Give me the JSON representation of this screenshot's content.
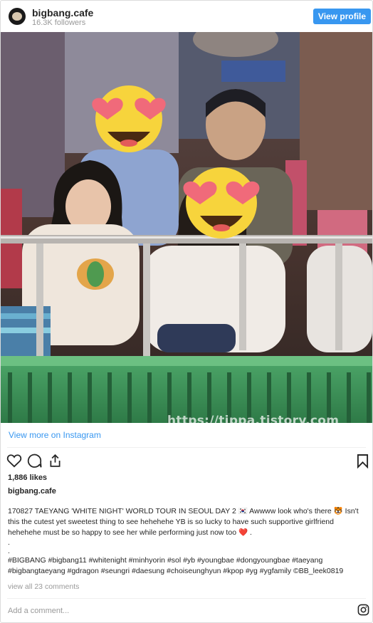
{
  "header": {
    "username": "bigbang.cafe",
    "followers": "16.3K followers",
    "view_profile_label": "View profile",
    "avatar_icon": "profile-avatar"
  },
  "photo": {
    "watermark": "https://tippa.tistory.com",
    "face_cover_icon": "heart-eyes-emoji"
  },
  "post": {
    "view_more_label": "View more on Instagram",
    "likes": "1,886 likes",
    "owner": "bigbang.cafe",
    "caption_text": "170827 TAEYANG 'WHITE NIGHT' WORLD TOUR IN SEOUL DAY 2 🇰🇷 Awwww look who's there 🐯 Isn't this the cutest yet sweetest thing to see hehehehe YB is so lucky to have such supportive girlfriend hehehehe must be so happy to see her while performing just now too ❤️ .",
    "dot1": ".",
    "dot2": ".",
    "hashtags": "#BIGBANG #bigbang11 #whitenight #minhyorin #sol #yb #youngbae #dongyoungbae #taeyang #bigbangtaeyang #gdragon #seungri #daesung #choiseunghyun #kpop #yg #ygfamily ©BB_leek0819",
    "view_comments": "view all 23 comments",
    "add_comment_placeholder": "Add a comment..."
  },
  "icons": {
    "like": "heart-outline-icon",
    "comment": "comment-bubble-icon",
    "share": "share-icon",
    "save": "bookmark-icon",
    "instagram": "instagram-logo-icon"
  },
  "colors": {
    "accent": "#3897f0",
    "text": "#262626",
    "muted": "#999999",
    "border": "#dbdbdb"
  }
}
